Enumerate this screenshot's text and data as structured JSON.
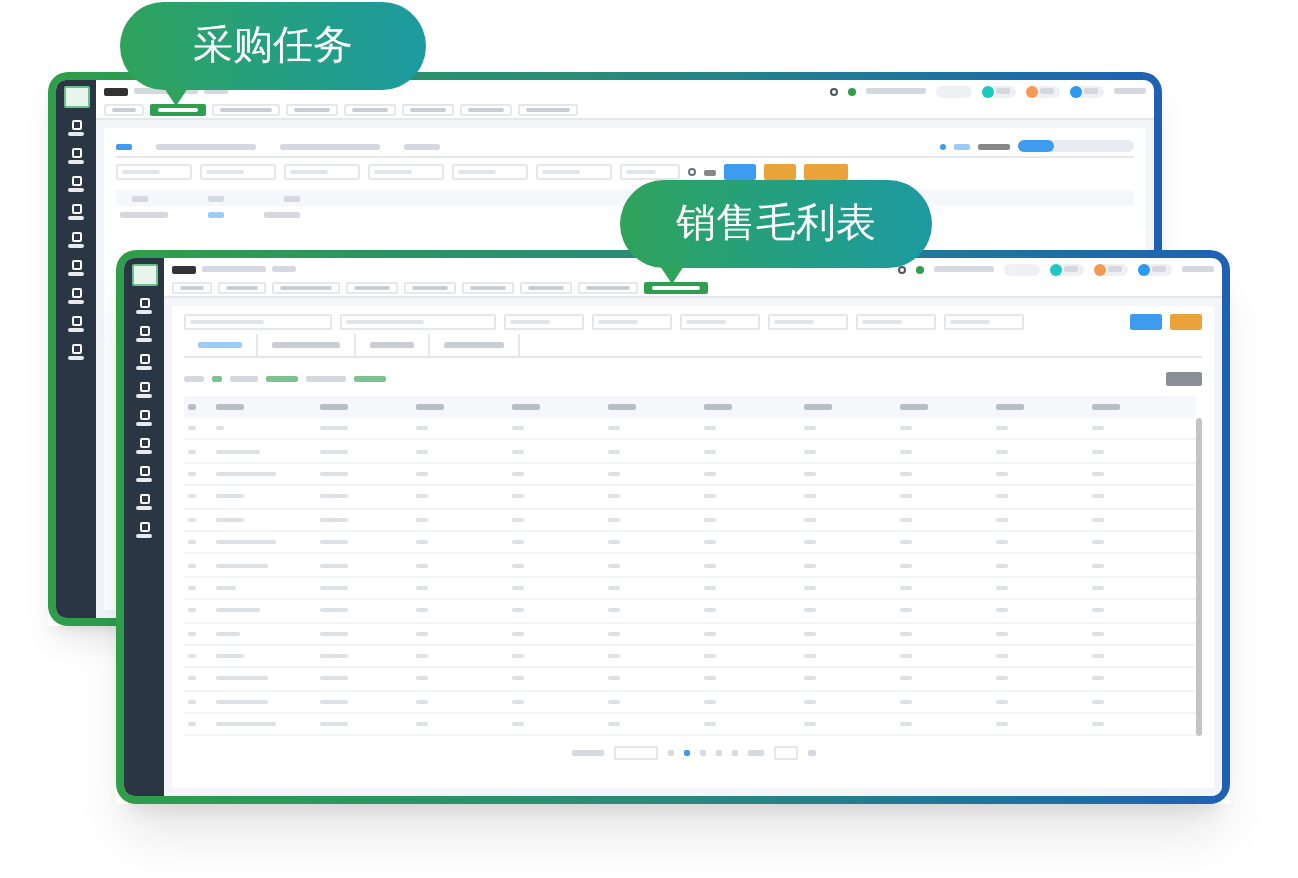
{
  "callouts": [
    {
      "text": "采购任务"
    },
    {
      "text": "销售毛利表"
    }
  ]
}
